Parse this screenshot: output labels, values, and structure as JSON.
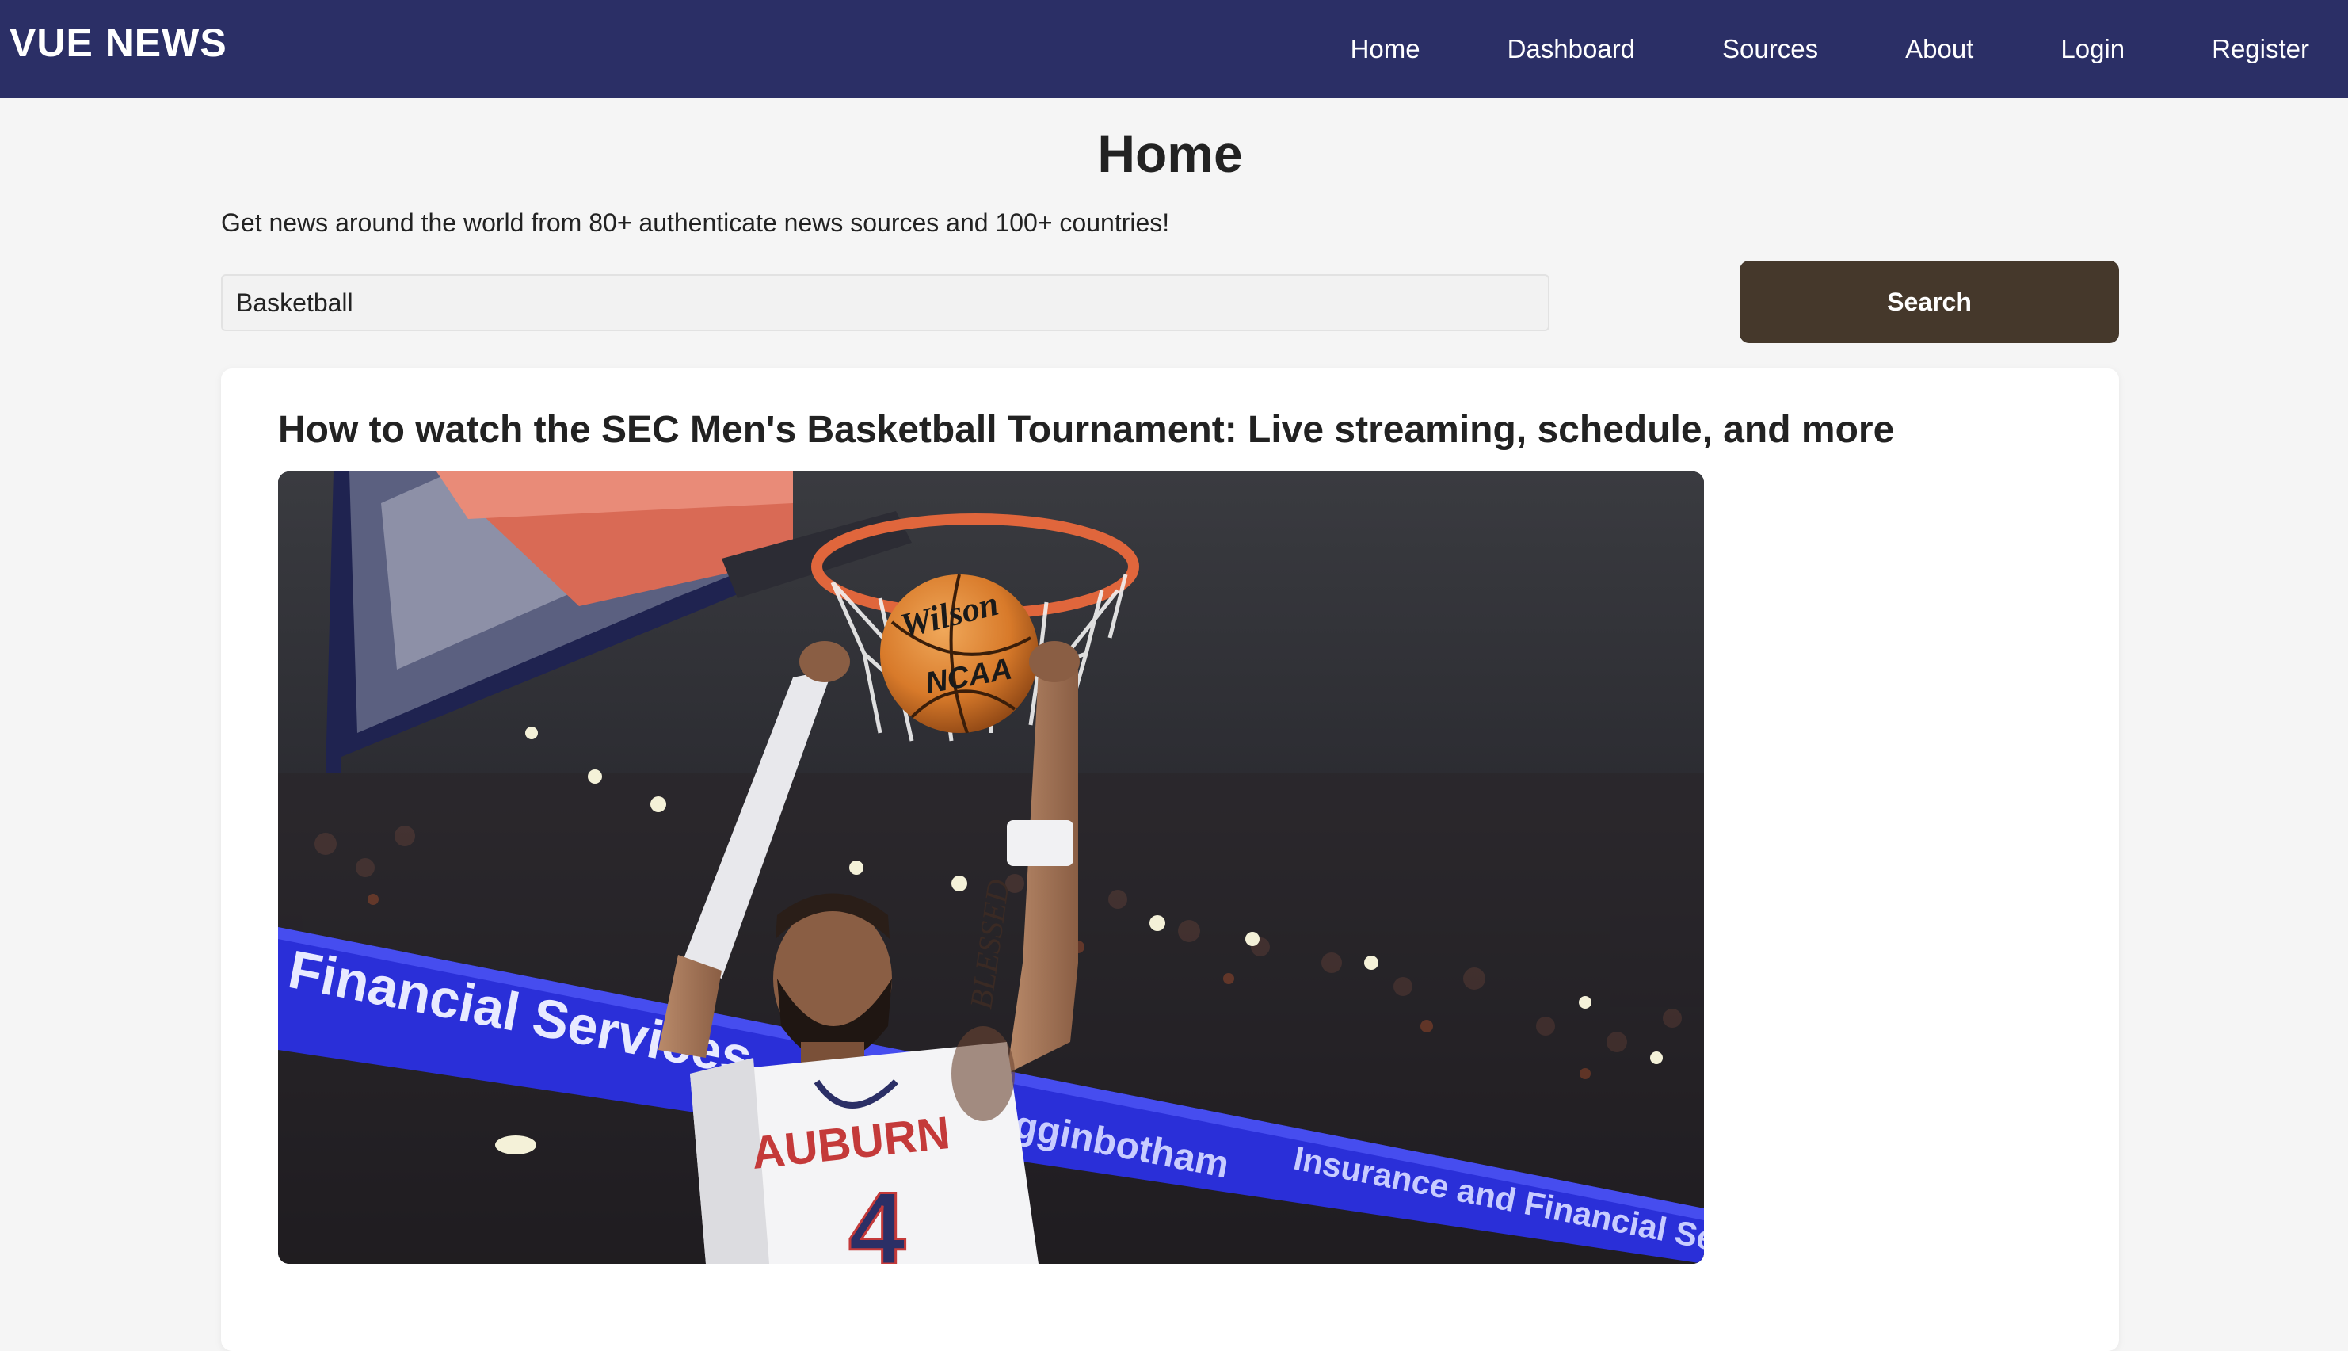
{
  "navbar": {
    "brand": "VUE NEWS",
    "links": [
      {
        "label": "Home"
      },
      {
        "label": "Dashboard"
      },
      {
        "label": "Sources"
      },
      {
        "label": "About"
      },
      {
        "label": "Login"
      },
      {
        "label": "Register"
      }
    ],
    "background_color": "#2b2f66"
  },
  "main": {
    "title": "Home",
    "subtitle": "Get news around the world from 80+ authenticate news sources and 100+ countries!",
    "search": {
      "value": "Basketball",
      "button_label": "Search",
      "button_color": "#45382b"
    }
  },
  "articles": [
    {
      "title": "How to watch the SEC Men's Basketball Tournament: Live streaming, schedule, and more",
      "image": {
        "ball_brand": "Wilson",
        "ball_league": "NCAA",
        "banner_text": "Financial Services",
        "banner_text_2": "Higginbotham",
        "banner_text_3": "Insurance and Financial Services",
        "jersey_name": "AUBURN",
        "jersey_number": "4",
        "tattoo_text": "BLESSED"
      }
    }
  ]
}
